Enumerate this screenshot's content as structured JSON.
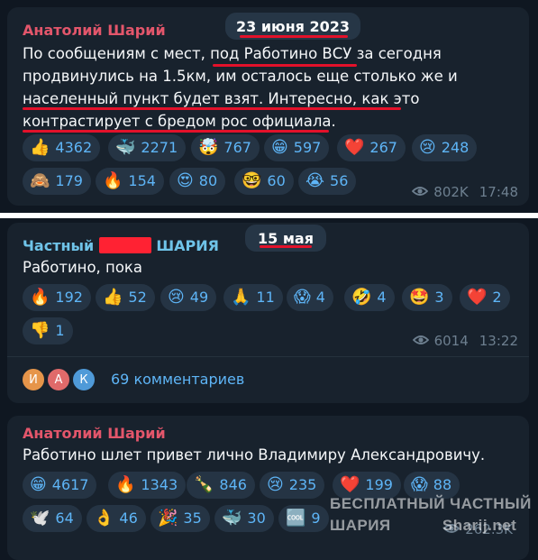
{
  "post1": {
    "author": "Анатолий Шарий",
    "date": "23 июня 2023",
    "lines": [
      "По сообщениям с мест, под Работино ВСУ за сегодня",
      "продвинулись  на 1.5км, им осталось еще столько же и",
      "населенный пункт будет взят. Интересно, как это",
      "контрастирует с бредом рос официала."
    ],
    "reactions": [
      {
        "emoji": "👍",
        "count": "4362"
      },
      {
        "emoji": "🐳",
        "count": "2271"
      },
      {
        "emoji": "🤯",
        "count": "767"
      },
      {
        "emoji": "😁",
        "count": "597"
      },
      {
        "emoji": "❤️",
        "count": "267"
      },
      {
        "emoji": "😢",
        "count": "248"
      },
      {
        "emoji": "🙈",
        "count": "179"
      },
      {
        "emoji": "🔥",
        "count": "154"
      },
      {
        "emoji": "😍",
        "count": "80"
      },
      {
        "emoji": "🤓",
        "count": "60"
      },
      {
        "emoji": "😭",
        "count": "56"
      }
    ],
    "views": "802K",
    "time": "17:48"
  },
  "post2": {
    "author_prefix": "Частный",
    "author_suffix": "ШАРИЯ",
    "date": "15 мая",
    "text": "Работино, пока",
    "reactions": [
      {
        "emoji": "🔥",
        "count": "192"
      },
      {
        "emoji": "👍",
        "count": "52"
      },
      {
        "emoji": "😢",
        "count": "49"
      },
      {
        "emoji": "🙏",
        "count": "11"
      },
      {
        "emoji": "😱",
        "count": "4"
      },
      {
        "emoji": "🤣",
        "count": "4"
      },
      {
        "emoji": "🤩",
        "count": "3"
      },
      {
        "emoji": "❤️",
        "count": "2"
      },
      {
        "emoji": "👎",
        "count": "1"
      }
    ],
    "views": "6014",
    "time": "13:22",
    "avatars": [
      "И",
      "А",
      "К"
    ],
    "comments": "69 комментариев"
  },
  "post3": {
    "author": "Анатолий Шарий",
    "text": "Работино шлет привет лично Владимиру Александровичу.",
    "reactions": [
      {
        "emoji": "😁",
        "count": "4617"
      },
      {
        "emoji": "🔥",
        "count": "1343"
      },
      {
        "emoji": "🍾",
        "count": "846"
      },
      {
        "emoji": "😢",
        "count": "235"
      },
      {
        "emoji": "❤️",
        "count": "199"
      },
      {
        "emoji": "😱",
        "count": "88"
      },
      {
        "emoji": "🕊️",
        "count": "64"
      },
      {
        "emoji": "👌",
        "count": "46"
      },
      {
        "emoji": "🎉",
        "count": "35"
      },
      {
        "emoji": "🐳",
        "count": "30"
      },
      {
        "emoji": "🆒",
        "count": "9"
      }
    ],
    "views": "262.3K"
  },
  "watermark": {
    "line1": "БЕСПЛАТНЫЙ ЧАСТНЫЙ",
    "line2": "ШАРИЯ",
    "site": "Sharij.net"
  },
  "colors": {
    "author_red": "#e3566b",
    "author_cyan": "#6fc4e9",
    "accent": "#5eb5f7",
    "underline": "#e3112a"
  }
}
